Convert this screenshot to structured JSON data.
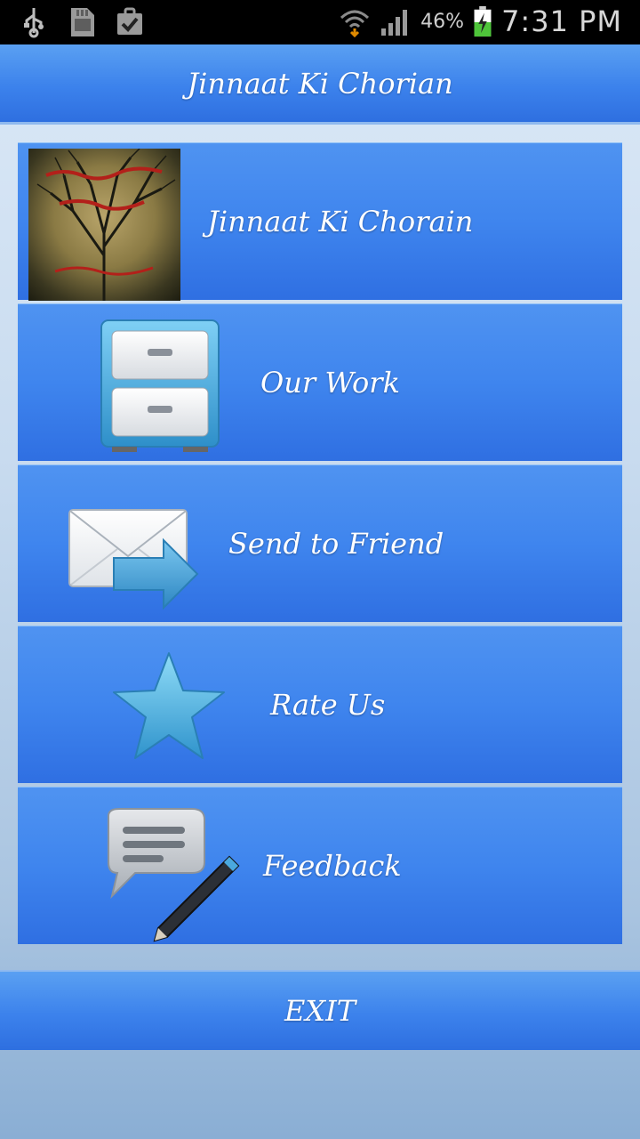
{
  "status_bar": {
    "battery_percent": "46%",
    "time": "7:31 PM"
  },
  "header": {
    "title": "Jinnaat Ki Chorian"
  },
  "menu": {
    "items": [
      {
        "label": "Jinnaat Ki Chorain",
        "icon": "book-cover-thumbnail"
      },
      {
        "label": "Our Work",
        "icon": "file-cabinet-icon"
      },
      {
        "label": "Send to Friend",
        "icon": "mail-forward-icon"
      },
      {
        "label": "Rate Us",
        "icon": "star-icon"
      },
      {
        "label": "Feedback",
        "icon": "feedback-chat-pen-icon"
      }
    ]
  },
  "footer": {
    "exit_label": "EXIT"
  },
  "colors": {
    "bar_blue": "#3c82ec",
    "status_bar": "#000000",
    "text": "#ffffff"
  }
}
